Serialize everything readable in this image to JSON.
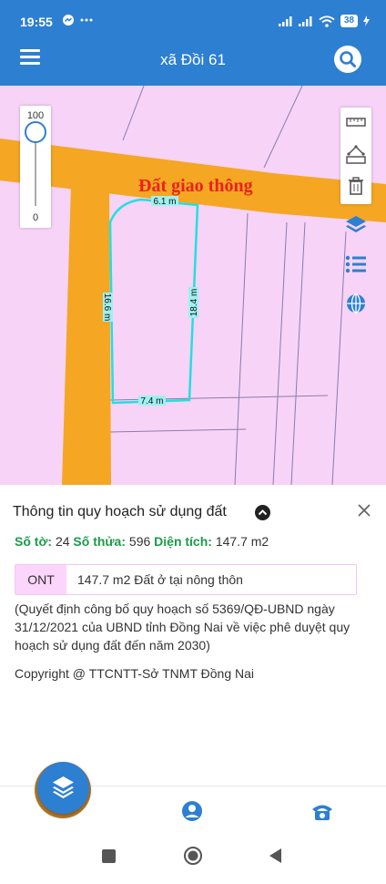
{
  "status_bar": {
    "time": "19:55",
    "notification_icons": "messenger-icon, more-icon",
    "battery": "38",
    "indicator_icons": [
      "signal-icon",
      "signal-icon",
      "wifi-icon",
      "battery-icon",
      "charging-icon"
    ]
  },
  "app_bar": {
    "title": "xã Đồi 61",
    "menu_icon": "menu-icon",
    "search_icon": "search-icon"
  },
  "map": {
    "road_label": "Đất giao thông",
    "zoom_max": "100",
    "zoom_min": "0",
    "zoom_level_fraction": 0.0,
    "parcel_dimensions": {
      "top": "6.1 m",
      "left": "16.6 m",
      "right": "18.4 m",
      "bottom": "7.4 m"
    },
    "tool_icons": [
      "measure-distance-icon",
      "measure-area-icon",
      "trash-icon"
    ],
    "side_icons": [
      "layers-icon",
      "list-icon",
      "globe-icon"
    ],
    "colors": {
      "residential": "#f7d3f7",
      "road": "#f5a623",
      "parcel_outline": "#22e0e0",
      "road_label": "#e8231e"
    }
  },
  "info_panel": {
    "title": "Thông tin quy hoạch sử dụng đất",
    "sheet_label": "Số tờ:",
    "sheet_value": "24",
    "parcel_label": "Số thửa:",
    "parcel_value": "596",
    "area_label": "Diện tích:",
    "area_value": "147.7 m2",
    "zone_code": "ONT",
    "zone_description": "147.7 m2 Đất ở tại nông thôn",
    "note": "(Quyết định công bố quy hoạch số 5369/QĐ-UBND ngày 31/12/2021 của UBND tỉnh Đồng Nai về việc phê duyệt quy hoạch sử dụng đất đến năm 2030)",
    "copyright": "Copyright @ TTCNTT-Sở TNMT Đồng Nai"
  },
  "bottom_nav": {
    "items": [
      "layers-icon",
      "account-icon",
      "phone-icon"
    ]
  },
  "system_nav": [
    "recents-icon",
    "home-icon",
    "back-icon"
  ]
}
